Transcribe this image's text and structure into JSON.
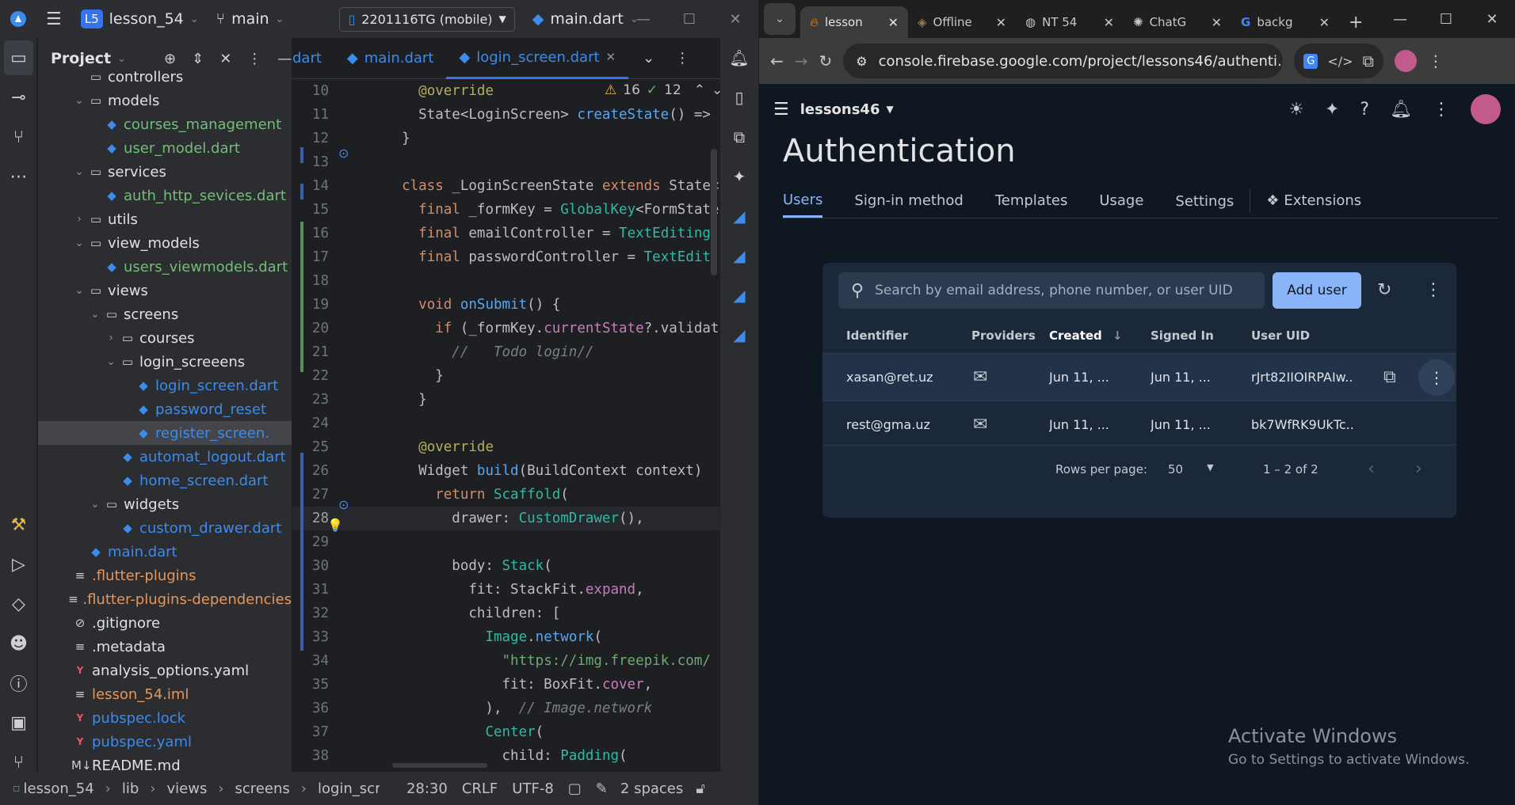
{
  "ide": {
    "project_badge": "L5",
    "project_name": "lesson_54",
    "branch": "main",
    "device": "2201116TG (mobile)",
    "run_config": "main.dart",
    "panel_title": "Project",
    "tree": [
      {
        "label": "controllers",
        "kind": "folder",
        "depth": 2,
        "arrow": "",
        "color": "normal"
      },
      {
        "label": "models",
        "kind": "folder",
        "depth": 2,
        "arrow": "⌄",
        "color": "normal"
      },
      {
        "label": "courses_management",
        "kind": "dart",
        "depth": 3,
        "arrow": "",
        "color": "green"
      },
      {
        "label": "user_model.dart",
        "kind": "dart",
        "depth": 3,
        "arrow": "",
        "color": "green"
      },
      {
        "label": "services",
        "kind": "folder",
        "depth": 2,
        "arrow": "⌄",
        "color": "normal"
      },
      {
        "label": "auth_http_sevices.dart",
        "kind": "dart",
        "depth": 3,
        "arrow": "",
        "color": "green"
      },
      {
        "label": "utils",
        "kind": "folder",
        "depth": 2,
        "arrow": "›",
        "color": "normal"
      },
      {
        "label": "view_models",
        "kind": "folder",
        "depth": 2,
        "arrow": "⌄",
        "color": "normal"
      },
      {
        "label": "users_viewmodels.dart",
        "kind": "dart",
        "depth": 3,
        "arrow": "",
        "color": "green"
      },
      {
        "label": "views",
        "kind": "folder",
        "depth": 2,
        "arrow": "⌄",
        "color": "normal"
      },
      {
        "label": "screens",
        "kind": "folder",
        "depth": 3,
        "arrow": "⌄",
        "color": "normal"
      },
      {
        "label": "courses",
        "kind": "folder",
        "depth": 4,
        "arrow": "›",
        "color": "normal"
      },
      {
        "label": "login_screeens",
        "kind": "folder",
        "depth": 4,
        "arrow": "⌄",
        "color": "normal"
      },
      {
        "label": "login_screen.dart",
        "kind": "dart",
        "depth": 5,
        "arrow": "",
        "color": "dart"
      },
      {
        "label": "password_reset",
        "kind": "dart",
        "depth": 5,
        "arrow": "",
        "color": "dart"
      },
      {
        "label": "register_screen.",
        "kind": "dart",
        "depth": 5,
        "arrow": "",
        "color": "dart",
        "selected": true
      },
      {
        "label": "automat_logout.dart",
        "kind": "dart",
        "depth": 4,
        "arrow": "",
        "color": "dart"
      },
      {
        "label": "home_screen.dart",
        "kind": "dart",
        "depth": 4,
        "arrow": "",
        "color": "dart"
      },
      {
        "label": "widgets",
        "kind": "folder",
        "depth": 3,
        "arrow": "⌄",
        "color": "normal"
      },
      {
        "label": "custom_drawer.dart",
        "kind": "dart",
        "depth": 4,
        "arrow": "",
        "color": "dart"
      },
      {
        "label": "main.dart",
        "kind": "dart",
        "depth": 2,
        "arrow": "",
        "color": "dart"
      },
      {
        "label": ".flutter-plugins",
        "kind": "text",
        "depth": 1,
        "arrow": "",
        "color": "orange"
      },
      {
        "label": ".flutter-plugins-dependencies",
        "kind": "text",
        "depth": 1,
        "arrow": "",
        "color": "orange"
      },
      {
        "label": ".gitignore",
        "kind": "ignore",
        "depth": 1,
        "arrow": "",
        "color": "normal"
      },
      {
        "label": ".metadata",
        "kind": "text",
        "depth": 1,
        "arrow": "",
        "color": "normal"
      },
      {
        "label": "analysis_options.yaml",
        "kind": "yaml",
        "depth": 1,
        "arrow": "",
        "color": "normal"
      },
      {
        "label": "lesson_54.iml",
        "kind": "text",
        "depth": 1,
        "arrow": "",
        "color": "orange"
      },
      {
        "label": "pubspec.lock",
        "kind": "yaml",
        "depth": 1,
        "arrow": "",
        "color": "dart"
      },
      {
        "label": "pubspec.yaml",
        "kind": "yaml",
        "depth": 1,
        "arrow": "",
        "color": "dart"
      },
      {
        "label": "README.md",
        "kind": "md",
        "depth": 1,
        "arrow": "",
        "color": "normal"
      }
    ],
    "tabs": [
      {
        "label": "dart",
        "active": false
      },
      {
        "label": "main.dart",
        "active": false
      },
      {
        "label": "login_screen.dart",
        "active": true
      }
    ],
    "inspections": {
      "warnings": "16",
      "weak": "12"
    },
    "code": [
      {
        "n": "10",
        "html": "    <span class='an'>@override</span>"
      },
      {
        "n": "11",
        "html": "    State&lt;LoginScreen&gt; <span class='fn'>createState</span>() =&gt;"
      },
      {
        "n": "12",
        "html": "  }"
      },
      {
        "n": "13",
        "html": ""
      },
      {
        "n": "14",
        "html": "  <span class='kw'>class</span> _LoginScreenState <span class='kw'>extends</span> State&lt;"
      },
      {
        "n": "15",
        "html": "    <span class='kw'>final</span> _formKey = <span class='ty'>GlobalKey</span>&lt;FormState"
      },
      {
        "n": "16",
        "html": "    <span class='kw'>final</span> emailController = <span class='ty'>TextEditing</span>"
      },
      {
        "n": "17",
        "html": "    <span class='kw'>final</span> passwordController = <span class='ty'>TextEdit</span>"
      },
      {
        "n": "18",
        "html": ""
      },
      {
        "n": "19",
        "html": "    <span class='kw'>void</span> <span class='fn'>onSubmit</span>() {"
      },
      {
        "n": "20",
        "html": "      <span class='kw'>if</span> (_formKey.<span class='pr'>currentState</span>?.validat"
      },
      {
        "n": "21",
        "html": "        <span class='cm'>//   Todo login//</span>"
      },
      {
        "n": "22",
        "html": "      }"
      },
      {
        "n": "23",
        "html": "    }"
      },
      {
        "n": "24",
        "html": ""
      },
      {
        "n": "25",
        "html": "    <span class='an'>@override</span>"
      },
      {
        "n": "26",
        "html": "    Widget <span class='fn'>build</span>(BuildContext context) "
      },
      {
        "n": "27",
        "html": "      <span class='kw'>return</span> <span class='ty'>Scaffold</span>("
      },
      {
        "n": "28",
        "html": "        drawer: <span class='ty'>CustomDrawer</span>(),"
      },
      {
        "n": "29",
        "html": ""
      },
      {
        "n": "30",
        "html": "        body: <span class='ty'>Stack</span>("
      },
      {
        "n": "31",
        "html": "          fit: StackFit.<span class='pr'>expand</span>,"
      },
      {
        "n": "32",
        "html": "          children: ["
      },
      {
        "n": "33",
        "html": "            <span class='ty'>Image</span>.<span class='fn'>network</span>("
      },
      {
        "n": "34",
        "html": "              <span class='str'>\"https://img.freepik.com/</span>"
      },
      {
        "n": "35",
        "html": "              fit: BoxFit.<span class='pr'>cover</span>,"
      },
      {
        "n": "36",
        "html": "            ),  <span class='cm'>// Image.network</span>"
      },
      {
        "n": "37",
        "html": "            <span class='ty'>Center</span>("
      },
      {
        "n": "38",
        "html": "              child: <span class='ty'>Padding</span>("
      }
    ],
    "status": {
      "breadcrumb": [
        "lesson_54",
        "lib",
        "views",
        "screens",
        "login_screeens"
      ],
      "position": "28:30",
      "line_sep": "CRLF",
      "encoding": "UTF-8",
      "indent": "2 spaces"
    }
  },
  "browser": {
    "tabs": [
      {
        "label": "lesson",
        "active": true
      },
      {
        "label": "Offline",
        "active": false
      },
      {
        "label": "NT 54",
        "active": false
      },
      {
        "label": "ChatG",
        "active": false
      },
      {
        "label": "backg",
        "active": false
      }
    ],
    "url": "console.firebase.google.com/project/lessons46/authenti...",
    "firebase": {
      "project": "lessons46",
      "title": "Authentication",
      "tabs": [
        "Users",
        "Sign-in method",
        "Templates",
        "Usage",
        "Settings",
        "Extensions"
      ],
      "search_placeholder": "Search by email address, phone number, or user UID",
      "add_user": "Add user",
      "columns": {
        "identifier": "Identifier",
        "providers": "Providers",
        "created": "Created",
        "signed_in": "Signed In",
        "uid": "User UID"
      },
      "users": [
        {
          "identifier": "xasan@ret.uz",
          "created": "Jun 11, ...",
          "signed_in": "Jun 11, ...",
          "uid": "rJrt82IIOIRPAIw..."
        },
        {
          "identifier": "rest@gma.uz",
          "created": "Jun 11, ...",
          "signed_in": "Jun 11, ...",
          "uid": "bk7WfRK9UkTc..."
        }
      ],
      "rows_per_page_label": "Rows per page:",
      "rows_per_page": "50",
      "range": "1 – 2 of 2"
    },
    "watermark": {
      "line1": "Activate Windows",
      "line2": "Go to Settings to activate Windows."
    }
  },
  "colors": {
    "accent": "#3574f0",
    "firebase_blue": "#8ab4f8"
  }
}
